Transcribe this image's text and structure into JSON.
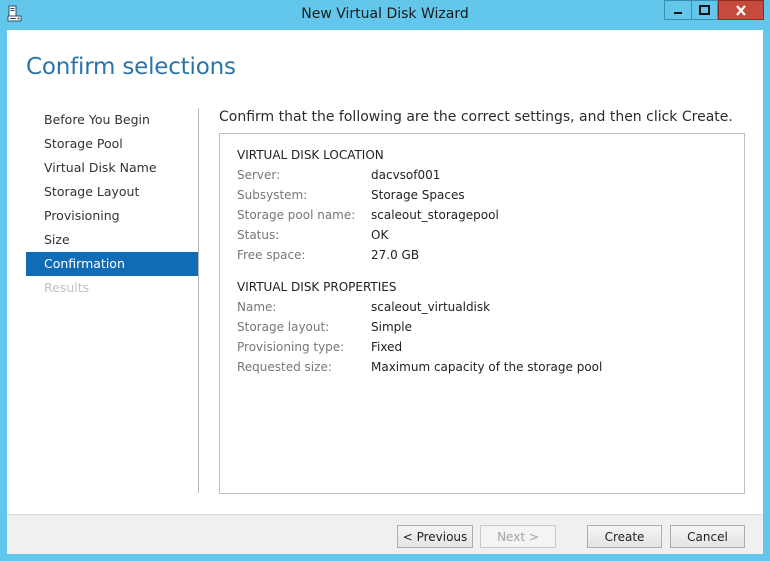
{
  "window": {
    "title": "New Virtual Disk Wizard"
  },
  "page": {
    "heading": "Confirm selections",
    "instruction": "Confirm that the following are the correct settings, and then click Create."
  },
  "nav": {
    "items": [
      {
        "label": "Before You Begin",
        "state": "normal"
      },
      {
        "label": "Storage Pool",
        "state": "normal"
      },
      {
        "label": "Virtual Disk Name",
        "state": "normal"
      },
      {
        "label": "Storage Layout",
        "state": "normal"
      },
      {
        "label": "Provisioning",
        "state": "normal"
      },
      {
        "label": "Size",
        "state": "normal"
      },
      {
        "label": "Confirmation",
        "state": "active"
      },
      {
        "label": "Results",
        "state": "disabled"
      }
    ]
  },
  "location": {
    "title": "VIRTUAL DISK LOCATION",
    "rows": [
      {
        "label": "Server:",
        "value": "dacvsof001"
      },
      {
        "label": "Subsystem:",
        "value": "Storage Spaces"
      },
      {
        "label": "Storage pool name:",
        "value": "scaleout_storagepool"
      },
      {
        "label": "Status:",
        "value": "OK"
      },
      {
        "label": "Free space:",
        "value": "27.0 GB"
      }
    ]
  },
  "properties": {
    "title": "VIRTUAL DISK PROPERTIES",
    "rows": [
      {
        "label": "Name:",
        "value": "scaleout_virtualdisk"
      },
      {
        "label": "Storage layout:",
        "value": "Simple"
      },
      {
        "label": "Provisioning type:",
        "value": "Fixed"
      },
      {
        "label": "Requested size:",
        "value": "Maximum capacity of the storage pool"
      }
    ]
  },
  "buttons": {
    "previous": "< Previous",
    "next": "Next >",
    "create": "Create",
    "cancel": "Cancel"
  },
  "colors": {
    "titlebar": "#62c7ea",
    "accent": "#0f6cb5",
    "heading": "#2a74a8",
    "close": "#c74b3c"
  }
}
